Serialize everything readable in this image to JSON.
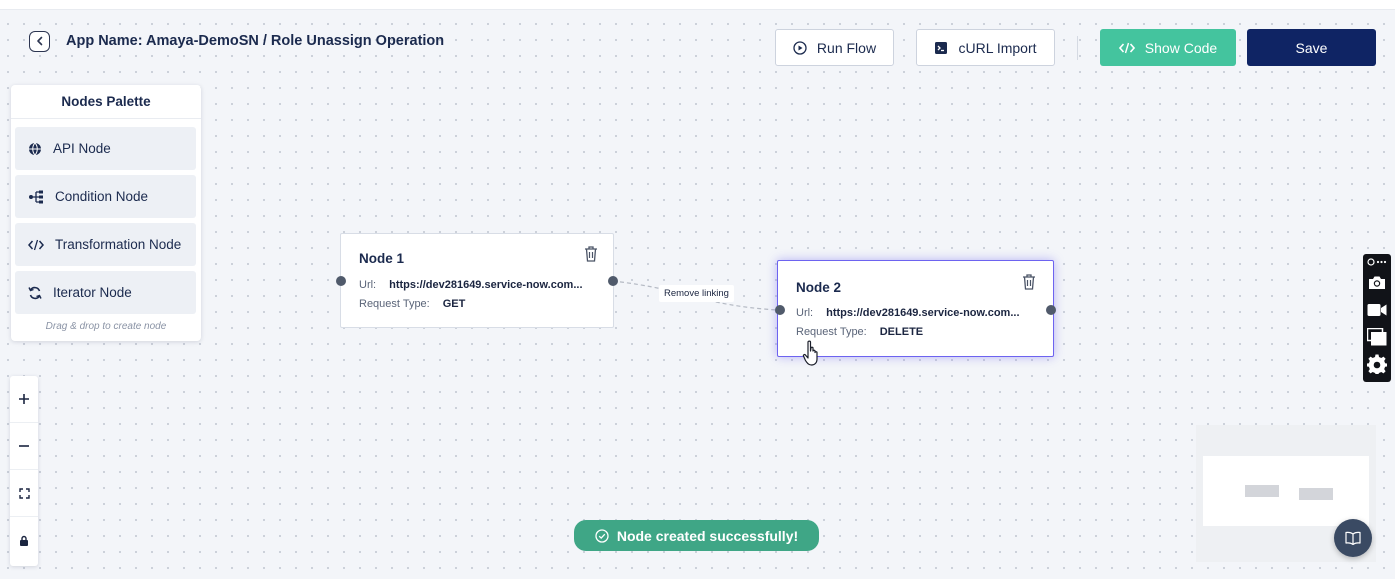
{
  "header": {
    "title": "App Name: Amaya-DemoSN / Role Unassign Operation",
    "back_icon": "chevron-left-icon"
  },
  "toolbar": {
    "run_flow_label": "Run Flow",
    "curl_import_label": "cURL Import",
    "show_code_label": "Show Code",
    "save_label": "Save"
  },
  "palette": {
    "title": "Nodes Palette",
    "items": [
      {
        "label": "API Node",
        "icon": "globe-icon"
      },
      {
        "label": "Condition Node",
        "icon": "branch-icon"
      },
      {
        "label": "Transformation Node",
        "icon": "code-icon"
      },
      {
        "label": "Iterator Node",
        "icon": "loop-icon"
      }
    ],
    "hint": "Drag & drop to create node"
  },
  "nodes": [
    {
      "title": "Node 1",
      "url_label": "Url:",
      "url": "https://dev281649.service-now.com...",
      "type_label": "Request Type:",
      "request_type": "GET"
    },
    {
      "title": "Node 2",
      "url_label": "Url:",
      "url": "https://dev281649.service-now.com...",
      "type_label": "Request Type:",
      "request_type": "DELETE"
    }
  ],
  "edge": {
    "label": "Remove linking"
  },
  "toast": {
    "message": "Node created successfully!"
  },
  "colors": {
    "primary": "#0f2464",
    "accent_green": "#44c49e",
    "toast_green": "#3fa686",
    "selected_border": "#6d63f0"
  }
}
